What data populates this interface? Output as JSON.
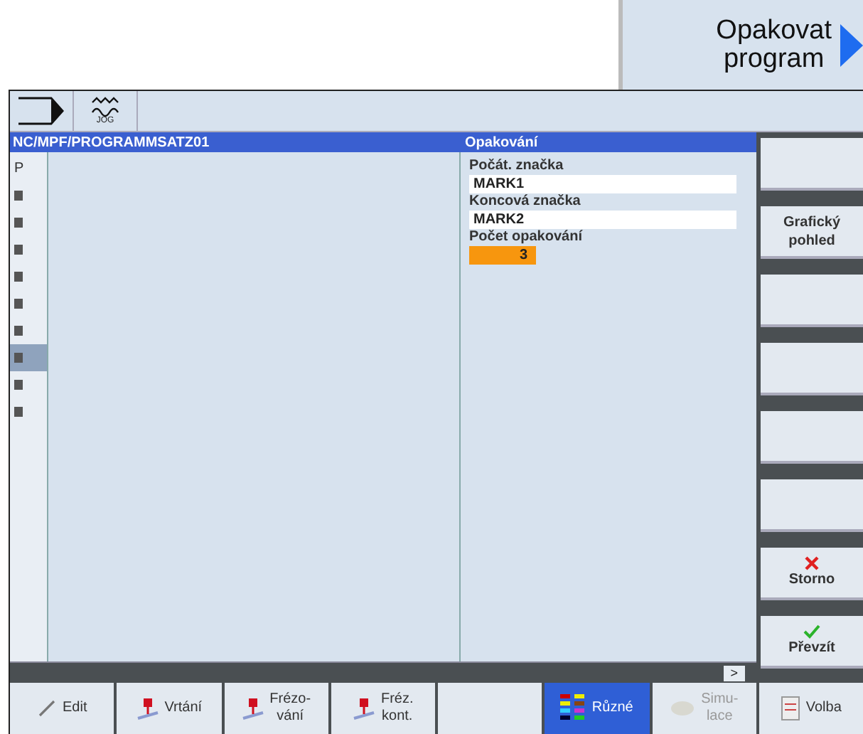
{
  "top_softkey": {
    "lines": [
      "Opakovat",
      "program"
    ]
  },
  "header": {
    "mode_label": "JOG"
  },
  "title_bar": {
    "path": "NC/MPF/PROGRAMMSATZ01",
    "panel_title": "Opakování"
  },
  "sidebar": {
    "items": [
      {
        "glyph": "P",
        "selected": false
      },
      {
        "selected": false
      },
      {
        "selected": false
      },
      {
        "selected": false
      },
      {
        "selected": false
      },
      {
        "selected": false
      },
      {
        "selected": false
      },
      {
        "selected": true
      },
      {
        "selected": false
      },
      {
        "selected": false
      }
    ]
  },
  "fields": [
    {
      "label": "Počát. značka",
      "value": "MARK1",
      "focused": false
    },
    {
      "label": "Koncová značka",
      "value": "MARK2",
      "focused": false
    },
    {
      "label": "Počet opakování",
      "value": "3",
      "focused": true
    }
  ],
  "status_bar": {
    "more": ">"
  },
  "vertical_softkeys": [
    {
      "kind": "plain"
    },
    {
      "lines": [
        "Grafický",
        "pohled"
      ],
      "kind": "plain"
    },
    {
      "kind": "plain"
    },
    {
      "kind": "plain"
    },
    {
      "kind": "plain"
    },
    {
      "kind": "plain"
    },
    {
      "lines": [
        "Storno"
      ],
      "kind": "cancel"
    },
    {
      "lines": [
        "Převzít"
      ],
      "kind": "accept"
    }
  ],
  "horizontal_softkeys": [
    {
      "lines": [
        "Edit"
      ],
      "kind": "edit",
      "selected": false
    },
    {
      "lines": [
        "Vrtání"
      ],
      "kind": "drill",
      "selected": false
    },
    {
      "lines": [
        "Frézo-",
        "vání"
      ],
      "kind": "mill",
      "selected": false
    },
    {
      "lines": [
        "Fréz.",
        "kont."
      ],
      "kind": "mill",
      "selected": false
    },
    {
      "kind": "plain",
      "selected": false
    },
    {
      "lines": [
        "Různé"
      ],
      "kind": "misc",
      "selected": true
    },
    {
      "lines": [
        "Simu-",
        "lace"
      ],
      "kind": "sim",
      "selected": false,
      "disabled": true
    },
    {
      "lines": [
        "Volba"
      ],
      "kind": "select",
      "selected": false
    }
  ]
}
